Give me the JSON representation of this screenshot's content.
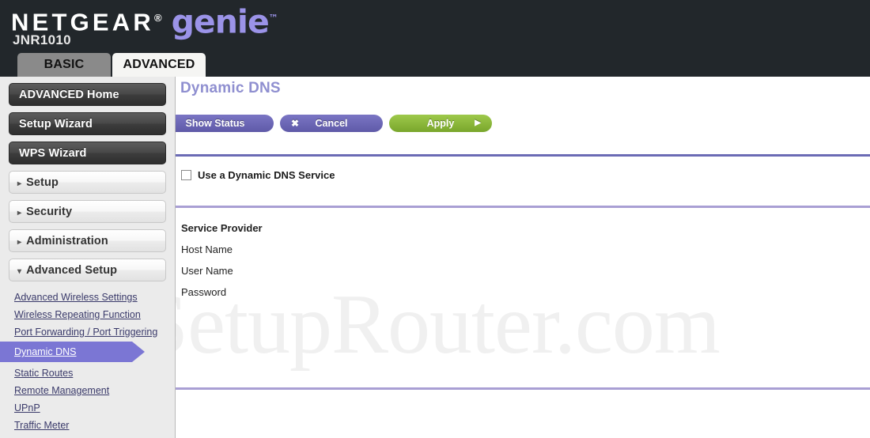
{
  "header": {
    "brand": "NETGEAR",
    "brand_reg": "®",
    "product": "genie",
    "product_tm": "™",
    "model": "JNR1010",
    "bg_color": "#22272b",
    "genie_color": "#9b93e8"
  },
  "tabs": [
    {
      "label": "BASIC",
      "active": false
    },
    {
      "label": "ADVANCED",
      "active": true
    }
  ],
  "sidebar": {
    "buttons": [
      {
        "label": "ADVANCED Home",
        "style": "dark"
      },
      {
        "label": "Setup Wizard",
        "style": "dark"
      },
      {
        "label": "WPS Wizard",
        "style": "dark"
      },
      {
        "label": "Setup",
        "style": "light",
        "caret": "▸"
      },
      {
        "label": "Security",
        "style": "light",
        "caret": "▸"
      },
      {
        "label": "Administration",
        "style": "light",
        "caret": "▸"
      },
      {
        "label": "Advanced Setup",
        "style": "light",
        "caret": "▾"
      }
    ],
    "submenu": [
      {
        "label": "Advanced Wireless Settings",
        "selected": false
      },
      {
        "label": "Wireless Repeating Function",
        "selected": false
      },
      {
        "label": "Port Forwarding / Port Triggering",
        "selected": false
      },
      {
        "label": "Dynamic DNS",
        "selected": true
      },
      {
        "label": "Static Routes",
        "selected": false
      },
      {
        "label": "Remote Management",
        "selected": false
      },
      {
        "label": "UPnP",
        "selected": false
      },
      {
        "label": "Traffic Meter",
        "selected": false
      }
    ],
    "selected_color": "#7b76d4",
    "bg_color": "#ebebeb"
  },
  "main": {
    "page_title": "Dynamic DNS",
    "page_title_color": "#8f8fd0",
    "buttons": {
      "show_status": "Show Status",
      "cancel": "Cancel",
      "cancel_icon": "✖",
      "apply": "Apply",
      "apply_icon": "▶",
      "apply_color": "#89b83c",
      "purple_color": "#6a65b4"
    },
    "checkbox": {
      "label": "Use a Dynamic DNS Service",
      "checked": false
    },
    "fields": [
      {
        "label": "Service Provider",
        "bold": true
      },
      {
        "label": "Host Name",
        "bold": false
      },
      {
        "label": "User Name",
        "bold": false
      },
      {
        "label": "Password",
        "bold": false
      }
    ],
    "divider_dark": "#6b6bb5",
    "divider_light": "#a99fd4"
  },
  "watermark": {
    "text": "SetupRouter.com"
  }
}
